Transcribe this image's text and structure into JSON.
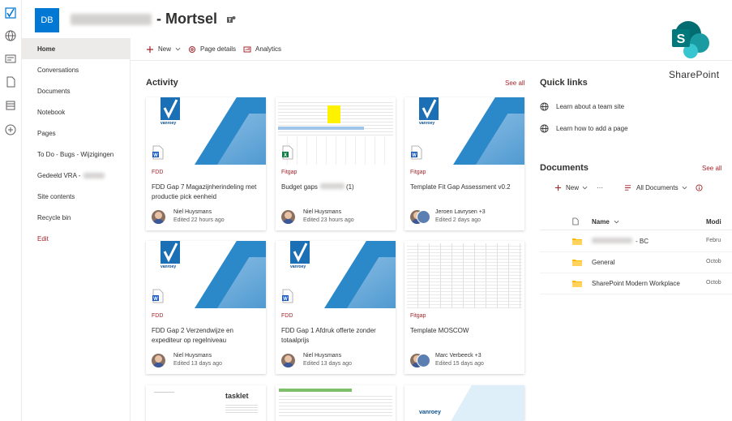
{
  "site": {
    "logo_initials": "DB",
    "title_suffix": "- Mortsel"
  },
  "brand": {
    "product_label": "SharePoint",
    "accent": "#a4262c",
    "logo_blue": "#0078d4",
    "sp_teal": "#038387"
  },
  "nav": {
    "items": [
      {
        "label": "Home"
      },
      {
        "label": "Conversations"
      },
      {
        "label": "Documents"
      },
      {
        "label": "Notebook"
      },
      {
        "label": "Pages"
      },
      {
        "label": "To Do - Bugs - Wijzigingen"
      },
      {
        "label": "Gedeeld VRA -"
      },
      {
        "label": "Site contents"
      },
      {
        "label": "Recycle bin"
      },
      {
        "label": "Edit"
      }
    ]
  },
  "commandbar": {
    "new_label": "New",
    "page_details_label": "Page details",
    "analytics_label": "Analytics"
  },
  "activity": {
    "title": "Activity",
    "see_all": "See all",
    "cards": [
      {
        "tag": "FDD",
        "title": "FDD Gap 7 Magazijnherindeling met productie pick eenheid",
        "person": "Niel Huysmans",
        "edited": "Edited 22 hours ago",
        "file_type": "word-icon"
      },
      {
        "tag": "Fitgap",
        "title": "Budget gaps (1)",
        "person": "Niel Huysmans",
        "edited": "Edited 23 hours ago",
        "file_type": "excel-icon"
      },
      {
        "tag": "Fitgap",
        "title": "Template Fit Gap Assessment v0.2",
        "person": "Jeroen Lavrysen +3",
        "edited": "Edited 2 days ago",
        "file_type": "word-icon"
      },
      {
        "tag": "FDD",
        "title": "FDD Gap 2 Verzendwijze en expediteur op regelniveau",
        "person": "Niel Huysmans",
        "edited": "Edited 13 days ago",
        "file_type": "word-icon"
      },
      {
        "tag": "FDD",
        "title": "FDD Gap 1 Afdruk offerte zonder totaalprijs",
        "person": "Niel Huysmans",
        "edited": "Edited 13 days ago",
        "file_type": "word-icon"
      },
      {
        "tag": "Fitgap",
        "title": "Template MOSCOW",
        "person": "Marc Verbeeck +3",
        "edited": "Edited 15 days ago",
        "file_type": "none"
      }
    ],
    "thumb_brand": "vanroey",
    "tasklet_brand": "tasklet"
  },
  "quick_links": {
    "title": "Quick links",
    "items": [
      {
        "label": "Learn about a team site"
      },
      {
        "label": "Learn how to add a page"
      }
    ]
  },
  "documents": {
    "title": "Documents",
    "see_all": "See all",
    "new_label": "New",
    "more_label": "···",
    "view_label": "All Documents",
    "col_name": "Name",
    "col_modified": "Modi",
    "rows": [
      {
        "name": "- BC",
        "modified": "Febru"
      },
      {
        "name": "General",
        "modified": "Octob"
      },
      {
        "name": "SharePoint Modern Workplace",
        "modified": "Octob"
      }
    ]
  }
}
